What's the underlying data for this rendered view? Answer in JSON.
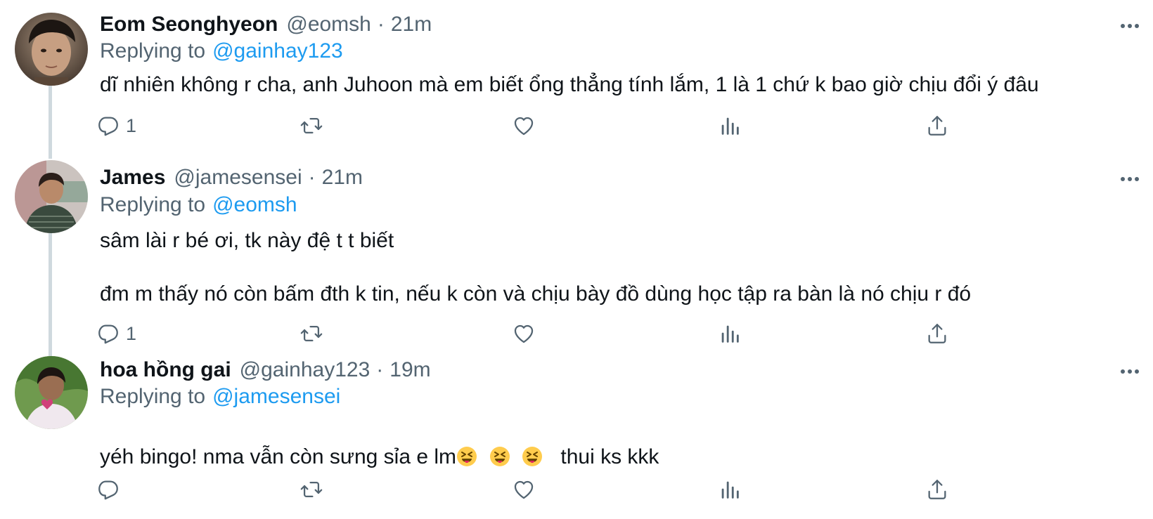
{
  "tweets": [
    {
      "name": "Eom Seonghyeon",
      "handle": "@eomsh",
      "time": "21m",
      "replying_prefix": "Replying to",
      "replying_to": "@gainhay123",
      "text_lines": [
        "dĩ nhiên không r cha, anh Juhoon mà em biết ổng thẳng tính lắm, 1 là 1 chứ k bao giờ chịu đổi ý đâu"
      ],
      "reply_count": "1",
      "icons": [
        "reply-icon",
        "retweet-icon",
        "like-icon",
        "analytics-icon",
        "share-icon",
        "more-icon"
      ]
    },
    {
      "name": "James",
      "handle": "@jamesensei",
      "time": "21m",
      "replying_prefix": "Replying to",
      "replying_to": "@eomsh",
      "text_lines": [
        "sâm lài r bé ơi, tk này đệ t t biết",
        "đm m thấy nó còn bấm đth k tin, nếu k còn và chịu bày đồ dùng học tập ra bàn là nó chịu r đó"
      ],
      "reply_count": "1",
      "icons": [
        "reply-icon",
        "retweet-icon",
        "like-icon",
        "analytics-icon",
        "share-icon",
        "more-icon"
      ]
    },
    {
      "name": "hoa hồng gai",
      "handle": "@gainhay123",
      "time": "19m",
      "replying_prefix": "Replying to",
      "replying_to": "@jamesensei",
      "text_before_emoji": "yéh bingo! nma vẫn còn sưng sỉa e lm",
      "text_after_emoji": "thui ks kkk",
      "emoji": [
        "squinting-face-with-tongue",
        "squinting-face-with-tongue",
        "squinting-face-with-tongue"
      ],
      "reply_count": "",
      "icons": [
        "reply-icon",
        "retweet-icon",
        "like-icon",
        "analytics-icon",
        "share-icon",
        "more-icon"
      ]
    }
  ],
  "colors": {
    "text": "#0f1419",
    "secondary": "#536471",
    "link": "#1d9bf0",
    "thread_line": "#cfd9de"
  }
}
